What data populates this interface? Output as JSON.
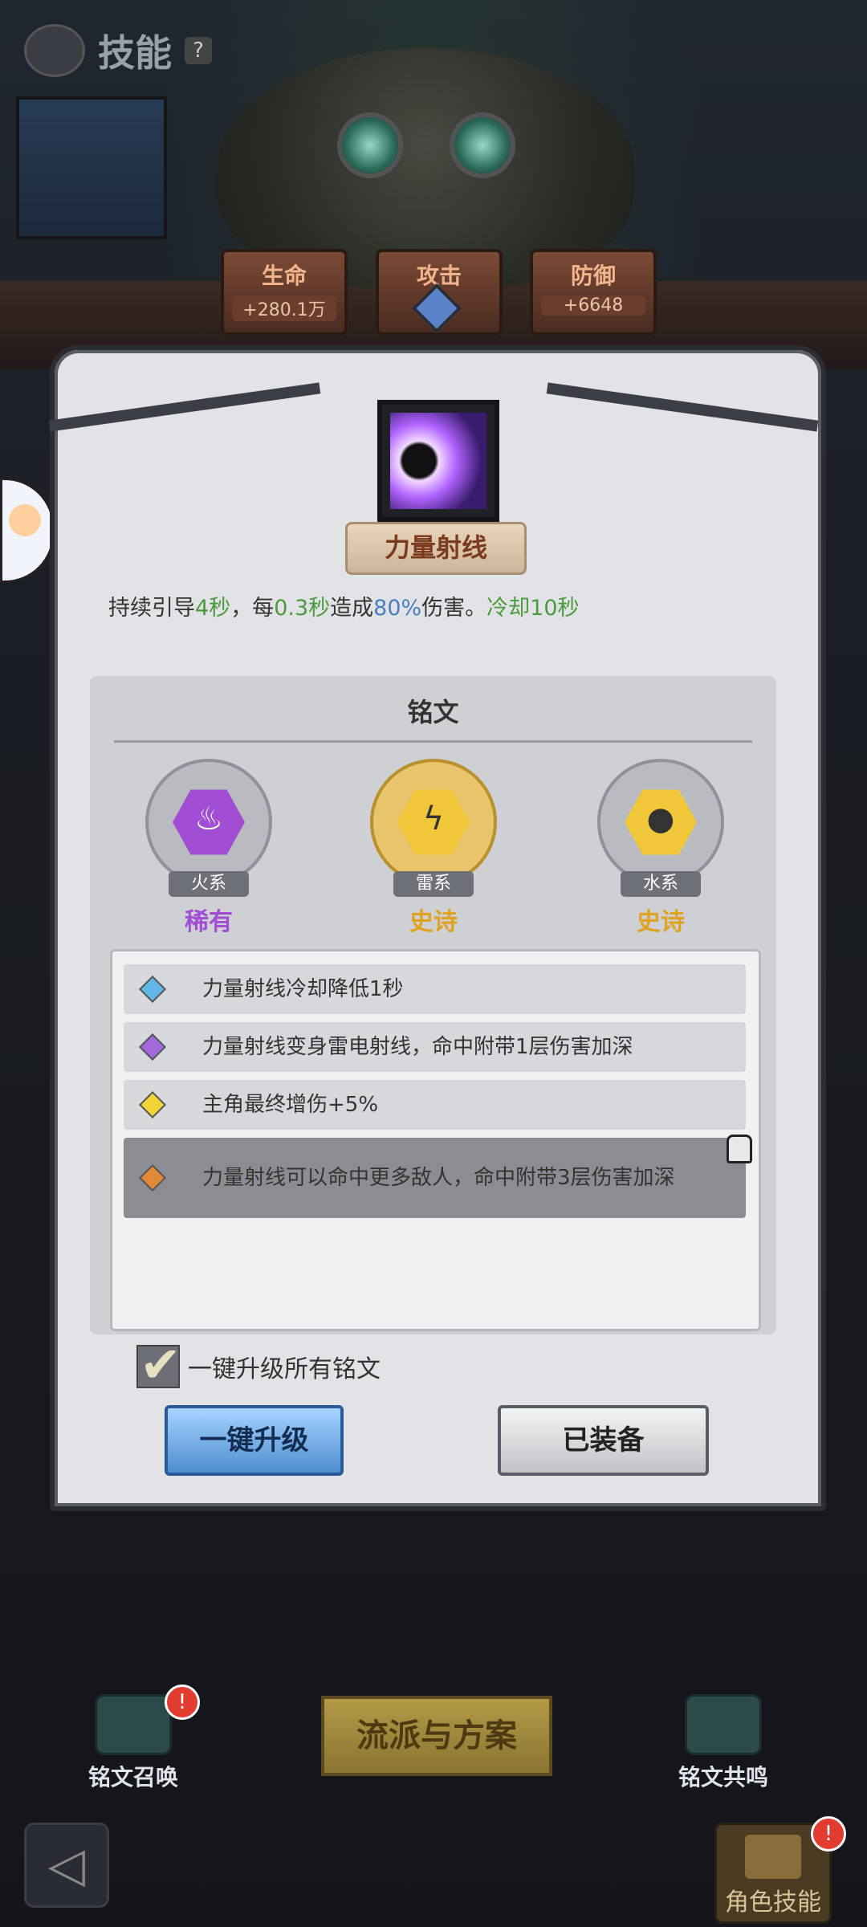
{
  "header": {
    "title": "技能",
    "help": "?"
  },
  "stats": [
    {
      "label": "生命",
      "value": "+280.1万"
    },
    {
      "label": "攻击",
      "value": ""
    },
    {
      "label": "防御",
      "value": "+6648"
    }
  ],
  "skill": {
    "name": "力量射线",
    "description": {
      "p1": "持续引导",
      "v1": "4秒",
      "p2": "，每",
      "v2": "0.3秒",
      "p3": "造成",
      "v3": "80%",
      "p4": "伤害。",
      "v4": "冷却10秒"
    }
  },
  "runes": {
    "title": "铭文",
    "items": [
      {
        "type": "火系",
        "rarity": "稀有",
        "icon": "fire-icon"
      },
      {
        "type": "雷系",
        "rarity": "史诗",
        "icon": "lightning-icon"
      },
      {
        "type": "水系",
        "rarity": "史诗",
        "icon": "water-drop-icon"
      }
    ]
  },
  "effects": [
    {
      "text": "力量射线冷却降低1秒",
      "gem_color": "#5fb8e6",
      "locked": false
    },
    {
      "text": "力量射线变身雷电射线，命中附带1层伤害加深",
      "gem_color": "#a36ae0",
      "locked": false
    },
    {
      "text": "主角最终增伤+5%",
      "gem_color": "#f1d33a",
      "locked": false
    },
    {
      "text": "力量射线可以命中更多敌人，命中附带3层伤害加深",
      "gem_color": "#e08a3a",
      "locked": true
    }
  ],
  "options": {
    "upgrade_all_label": "一键升级所有铭文"
  },
  "buttons": {
    "upgrade": "一键升级",
    "equipped": "已装备"
  },
  "bottom_nav": {
    "rune_summon": "铭文召唤",
    "strategy": "流派与方案",
    "rune_resonance": "铭文共鸣",
    "character_skill": "角色技能",
    "badge": "!"
  }
}
